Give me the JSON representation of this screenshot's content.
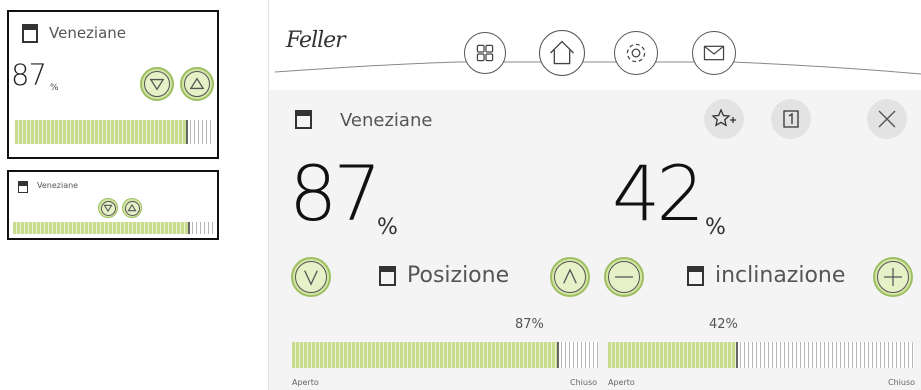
{
  "widget_large": {
    "title": "Veneziane",
    "value": "87",
    "unit": "%",
    "position_fraction": 0.87
  },
  "widget_small": {
    "title": "Veneziane",
    "position_fraction": 0.87
  },
  "panel": {
    "brand": "Feller",
    "nav": [
      "grid-icon",
      "home-icon",
      "gear-icon",
      "mail-icon"
    ],
    "title": "Veneziane",
    "header_actions": [
      "star-plus-icon",
      "door-icon",
      "close-icon"
    ],
    "position": {
      "value": "87",
      "unit": "%",
      "label": "Posizione",
      "bar_value": "87%",
      "bar_fraction": 0.87,
      "left_label": "Aperto",
      "right_label": "Chiuso"
    },
    "tilt": {
      "value": "42",
      "unit": "%",
      "label": "inclinazione",
      "bar_value": "42%",
      "bar_fraction": 0.42,
      "left_label": "Aperto",
      "right_label": "Chiuso"
    }
  },
  "colors": {
    "accent_green": "#c7dd8d",
    "button_green": "#d4e6a6",
    "panel_bg": "#f4f4f4"
  }
}
